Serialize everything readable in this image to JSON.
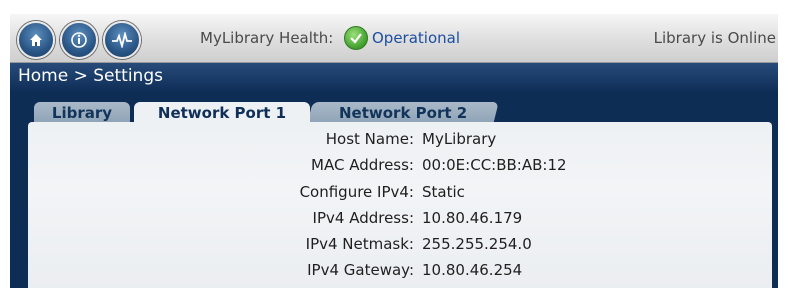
{
  "toolbar": {
    "health_label": "MyLibrary Health:",
    "health_status": "Operational",
    "status_text": "Library is Online",
    "buttons": {
      "home_icon": "home-icon",
      "info_icon": "info-icon",
      "pulse_icon": "activity-icon"
    }
  },
  "breadcrumb": "Home > Settings",
  "tabs": [
    {
      "label": "Library",
      "active": false
    },
    {
      "label": "Network Port 1",
      "active": true
    },
    {
      "label": "Network Port 2",
      "active": false
    }
  ],
  "fields": [
    {
      "label": "Host Name:",
      "value": "MyLibrary"
    },
    {
      "label": "MAC Address:",
      "value": "00:0E:CC:BB:AB:12"
    },
    {
      "label": "Configure IPv4:",
      "value": "Static"
    },
    {
      "label": "IPv4 Address:",
      "value": "10.80.46.179"
    },
    {
      "label": "IPv4 Netmask:",
      "value": "255.255.254.0"
    },
    {
      "label": "IPv4 Gateway:",
      "value": "10.80.46.254"
    }
  ],
  "colors": {
    "accent": "#1d4fa0",
    "header": "#0f2f58",
    "ok": "#3f9e2c"
  }
}
